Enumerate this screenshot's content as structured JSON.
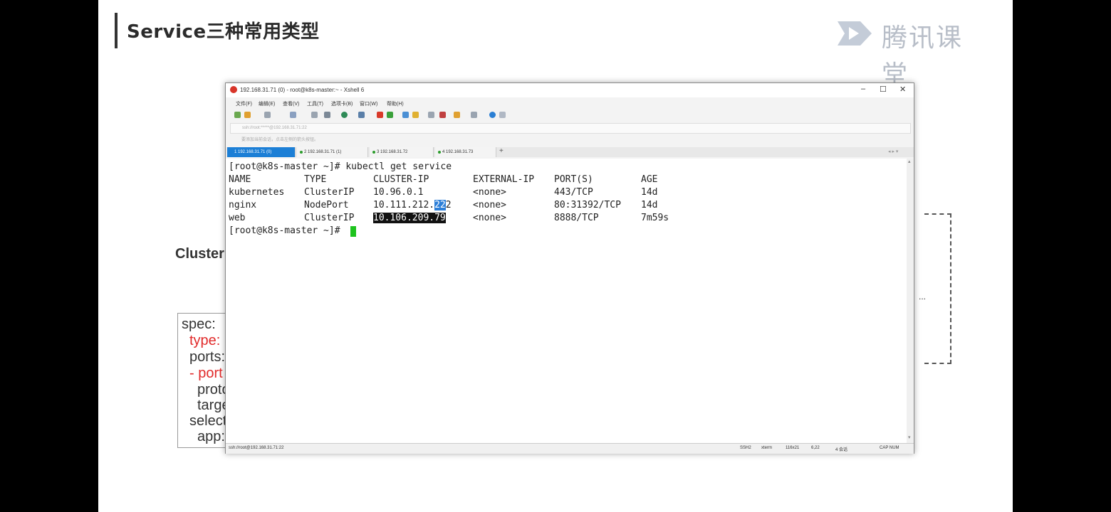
{
  "slide": {
    "title": "Service三种常用类型",
    "logo_text": "腾讯课堂",
    "label_partial": "ClusterI",
    "dash_dots": "...",
    "yaml": [
      "spec:",
      "type:",
      "ports:",
      "- port",
      "proto",
      "targe",
      "select",
      "app:"
    ]
  },
  "window": {
    "title": "192.168.31.71 (0) - root@k8s-master:~ - Xshell 6",
    "controls": {
      "minimize": "–",
      "maximize": "☐",
      "close": "✕"
    },
    "menu": [
      "文件(F)",
      "编辑(E)",
      "查看(V)",
      "工具(T)",
      "选项卡(B)",
      "窗口(W)",
      "帮助(H)"
    ],
    "address": "ssh://root:*****@192.168.31.71:22",
    "hint": "要添加当前会话，点击左侧的箭头按钮。",
    "tabs": [
      {
        "label": "1 192.168.31.71 (0)",
        "active": true
      },
      {
        "label": "2 192.168.31.71 (1)",
        "active": false
      },
      {
        "label": "3 192.168.31.72",
        "active": false
      },
      {
        "label": "4 192.168.31.73",
        "active": false
      }
    ],
    "tab_add": "+",
    "status": {
      "left": "ssh://root@192.168.31.71:22",
      "ssh": "SSH2",
      "term": "xterm",
      "size": "116x21",
      "pos": "6,22",
      "sessions": "4 会话",
      "caps": "CAP NUM"
    }
  },
  "terminal": {
    "command_line": "[root@k8s-master ~]# kubectl get service",
    "headers": [
      "NAME",
      "TYPE",
      "CLUSTER-IP",
      "EXTERNAL-IP",
      "PORT(S)",
      "AGE"
    ],
    "rows": [
      [
        "kubernetes",
        "ClusterIP",
        "10.96.0.1",
        "<none>",
        "443/TCP",
        "14d"
      ],
      [
        "nginx",
        "NodePort",
        "10.111.212.",
        "<none>",
        "80:31392/TCP",
        "14d"
      ],
      [
        "web",
        "ClusterIP",
        "10.106.209.79",
        "<none>",
        "8888/TCP",
        "7m59s"
      ]
    ],
    "nginx_ip_selected": "22",
    "nginx_ip_tail": "2",
    "prompt": "[root@k8s-master ~]# "
  }
}
